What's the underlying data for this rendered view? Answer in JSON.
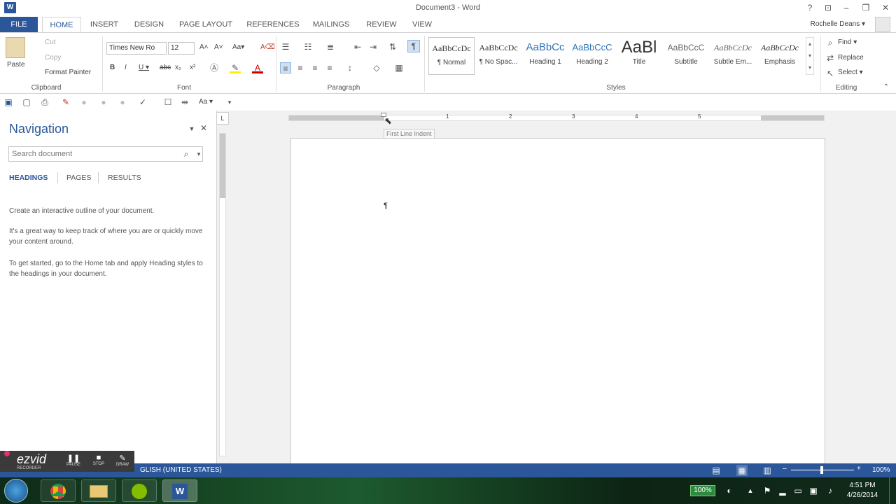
{
  "window": {
    "title": "Document3 - Word",
    "help": "?",
    "ribbon_display": "⊡",
    "minimize": "–",
    "restore": "❐",
    "close": "✕"
  },
  "tabs": [
    {
      "label": "FILE"
    },
    {
      "label": "HOME"
    },
    {
      "label": "INSERT"
    },
    {
      "label": "DESIGN"
    },
    {
      "label": "PAGE LAYOUT"
    },
    {
      "label": "REFERENCES"
    },
    {
      "label": "MAILINGS"
    },
    {
      "label": "REVIEW"
    },
    {
      "label": "VIEW"
    }
  ],
  "user": {
    "name": "Rochelle Deans ▾"
  },
  "clipboard": {
    "paste": "Paste",
    "cut": "Cut",
    "copy": "Copy",
    "format_painter": "Format Painter",
    "label": "Clipboard"
  },
  "font": {
    "name": "Times New Ro",
    "size": "12",
    "label": "Font",
    "grow": "A˄",
    "shrink": "A˅",
    "case": "Aa▾",
    "clear": "A⌫",
    "bold": "B",
    "italic": "I",
    "underline": "U ▾",
    "strike": "abc",
    "sub": "x₂",
    "sup": "x²"
  },
  "paragraph": {
    "label": "Paragraph",
    "pilcrow": "¶"
  },
  "styles": {
    "label": "Styles",
    "items": [
      {
        "sample": "AaBbCcDc",
        "name": "¶ Normal"
      },
      {
        "sample": "AaBbCcDc",
        "name": "¶ No Spac..."
      },
      {
        "sample": "AaBbCc",
        "name": "Heading 1"
      },
      {
        "sample": "AaBbCcC",
        "name": "Heading 2"
      },
      {
        "sample": "AaBl",
        "name": "Title"
      },
      {
        "sample": "AaBbCcC",
        "name": "Subtitle"
      },
      {
        "sample": "AaBbCcDc",
        "name": "Subtle Em..."
      },
      {
        "sample": "AaBbCcDc",
        "name": "Emphasis"
      }
    ]
  },
  "editing": {
    "find": "Find ▾",
    "replace": "Replace",
    "select": "Select ▾",
    "label": "Editing"
  },
  "qat": {
    "case": "Aa ▾"
  },
  "navigation": {
    "title": "Navigation",
    "search_placeholder": "Search document",
    "tabs": [
      "HEADINGS",
      "PAGES",
      "RESULTS"
    ],
    "paragraphs": [
      "Create an interactive outline of your document.",
      "It's a great way to keep track of where you are or quickly move your content around.",
      "To get started, go to the Home tab and apply Heading styles to the headings in your document."
    ]
  },
  "ruler": {
    "tooltip": "First Line Indent",
    "numbers": [
      "1",
      "2",
      "3",
      "4",
      "5"
    ]
  },
  "document": {
    "pilcrow": "¶"
  },
  "statusbar": {
    "language": "GLISH (UNITED STATES)",
    "zoom": "100%"
  },
  "recorder": {
    "brand": "ezvid",
    "sub": "RECORDER",
    "pause": "PAUSE",
    "stop": "STOP",
    "draw": "DRAW"
  },
  "taskbar": {
    "time": "4:51 PM",
    "date": "4/26/2014",
    "battery": "100%"
  }
}
